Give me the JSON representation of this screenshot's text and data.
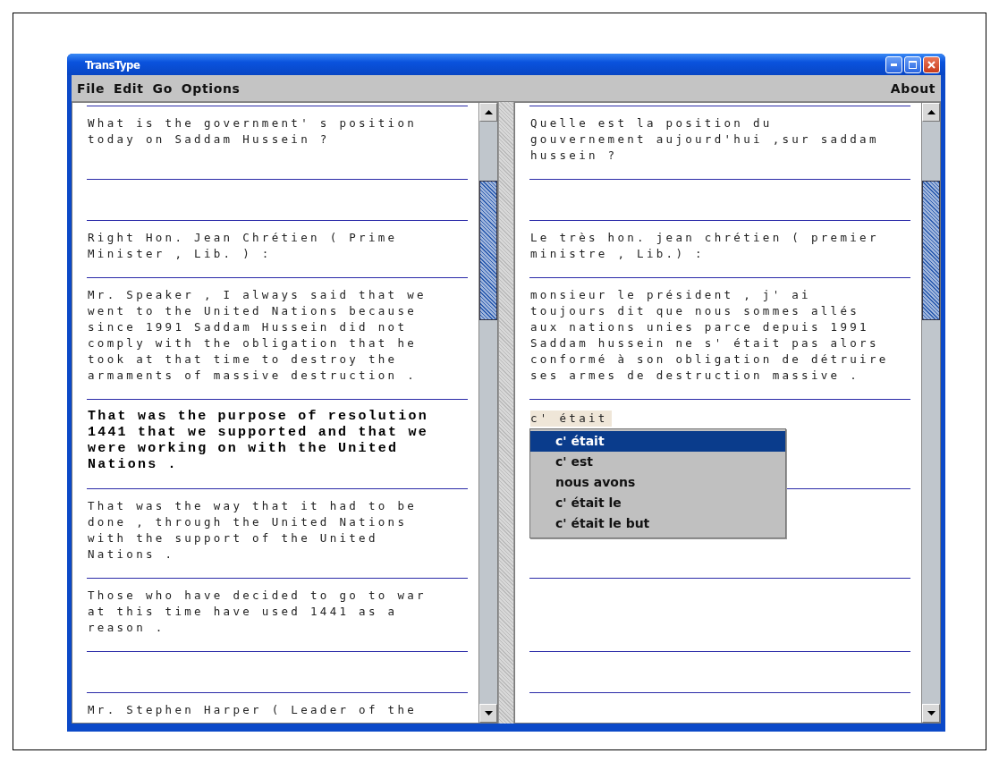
{
  "window": {
    "title": "TransType"
  },
  "menu": {
    "left": [
      "File",
      "Edit",
      "Go",
      "Options"
    ],
    "right": [
      "About"
    ]
  },
  "source_pane": {
    "segments": [
      {
        "text": "What is the government' s position\ntoday on Saddam Hussein ?",
        "current": false
      },
      {
        "kind": "blank"
      },
      {
        "text": "Right Hon. Jean Chrétien ( Prime\nMinister , Lib. ) :",
        "current": false
      },
      {
        "text": "Mr. Speaker , I always said that we\nwent to the United Nations because\nsince 1991 Saddam Hussein did not\ncomply with the obligation that he\ntook at that time to destroy the\narmaments of massive destruction .",
        "current": false
      },
      {
        "text": "That was the purpose of resolution\n1441 that we supported and that we\nwere working on with the United\nNations .",
        "current": true
      },
      {
        "text": "That was the way that it had to be\ndone , through the United Nations\nwith the support of the United\nNations .",
        "current": false
      },
      {
        "text": "Those who have decided to go to war\nat this time have used 1441 as a\nreason .",
        "current": false
      },
      {
        "kind": "blank"
      },
      {
        "text": "Mr. Stephen Harper ( Leader of the",
        "current": false
      }
    ]
  },
  "target_pane": {
    "segments": [
      {
        "kind": "text",
        "text": "Quelle est la position du\ngouvernement aujourd'hui ,sur saddam\nhussein ?"
      },
      {
        "kind": "blank"
      },
      {
        "kind": "text",
        "text": "Le très hon. jean chrétien ( premier\nministre , Lib.) :"
      },
      {
        "kind": "text",
        "text": "monsieur le président , j' ai\ntoujours dit que nous sommes allés\naux nations unies parce depuis 1991\nSaddam hussein ne s' était pas alors\nconformé à son obligation de détruire\nses armes de destruction massive ."
      },
      {
        "kind": "input",
        "text": "c' était"
      },
      {
        "kind": "blank"
      },
      {
        "kind": "blank"
      },
      {
        "kind": "blank"
      },
      {
        "kind": "blank"
      }
    ],
    "suggestions": [
      {
        "label": "c' était",
        "selected": true
      },
      {
        "label": "c' est",
        "selected": false
      },
      {
        "label": "nous avons",
        "selected": false
      },
      {
        "label": "c' était le",
        "selected": false
      },
      {
        "label": "c' était le but",
        "selected": false
      }
    ]
  }
}
